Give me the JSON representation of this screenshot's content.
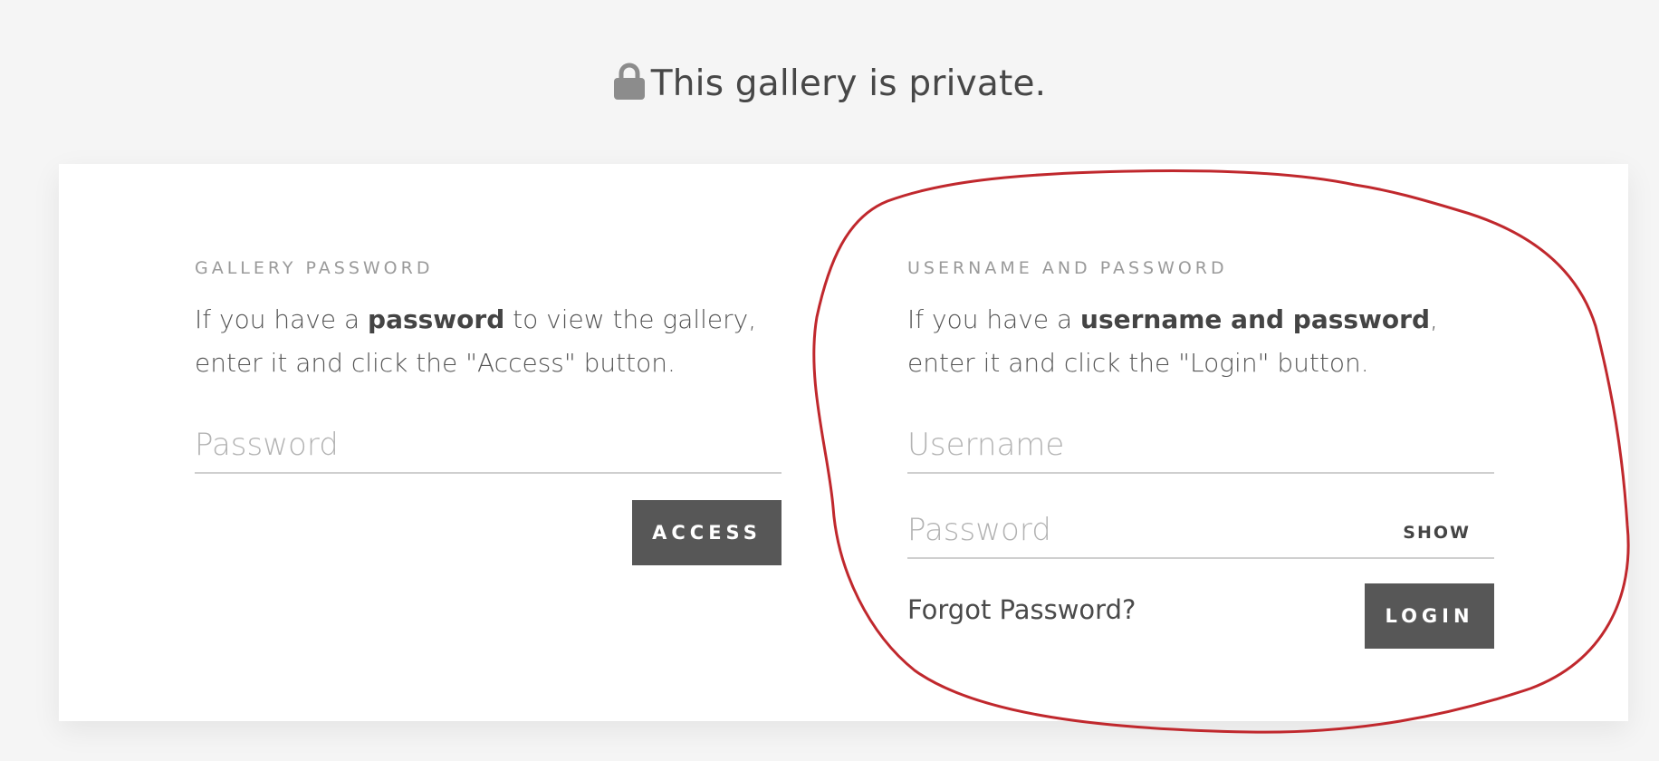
{
  "page": {
    "title": "This gallery is private."
  },
  "gallery_password": {
    "label": "GALLERY PASSWORD",
    "description_pre": "If you have a ",
    "description_bold": "password",
    "description_post": " to view the gallery, enter it and click the \"Access\" button.",
    "password_placeholder": "Password",
    "access_button": "ACCESS"
  },
  "user_login": {
    "label": "USERNAME AND PASSWORD",
    "description_pre": "If you have a ",
    "description_bold": "username and password",
    "description_post": ", enter it and click the \"Login\" button.",
    "username_placeholder": "Username",
    "password_placeholder": "Password",
    "show_label": "SHOW",
    "forgot_label": "Forgot Password?",
    "login_button": "LOGIN"
  },
  "colors": {
    "background": "#f5f5f5",
    "card": "#ffffff",
    "button": "#575757",
    "annotation": "#c0282d"
  },
  "icons": {
    "title_icon": "lock-icon"
  }
}
